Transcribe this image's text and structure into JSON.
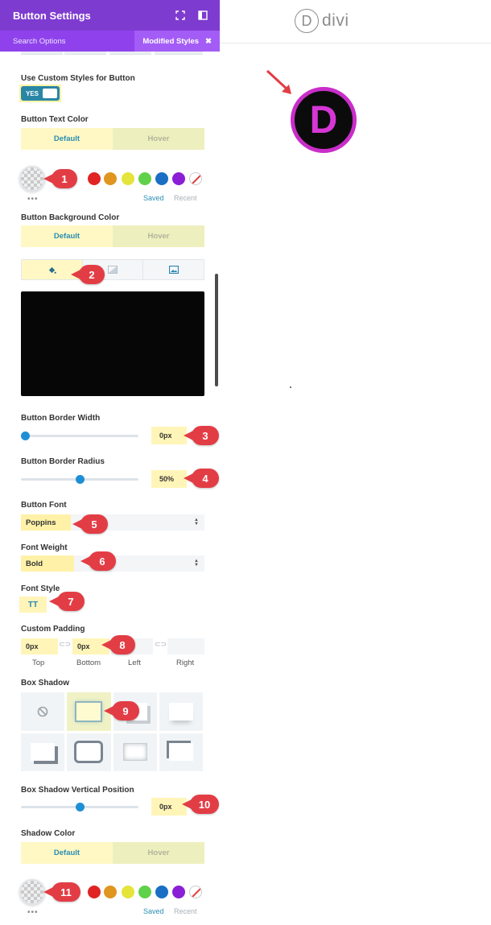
{
  "panel": {
    "title": "Button Settings",
    "search_options": "Search Options",
    "modified_styles": "Modified Styles"
  },
  "canvas": {
    "logo_letter": "D",
    "logo_word": "divi",
    "button_letter": "D"
  },
  "settings": {
    "use_custom_label": "Use Custom Styles for Button",
    "use_custom_value": "YES",
    "text_color_label": "Button Text Color",
    "bg_color_label": "Button Background Color",
    "tab_default": "Default",
    "tab_hover": "Hover",
    "saved": "Saved",
    "recent": "Recent",
    "border_width_label": "Button Border Width",
    "border_width_value": "0px",
    "border_width_level": 0,
    "border_radius_label": "Button Border Radius",
    "border_radius_value": "50%",
    "border_radius_level": 0.5,
    "font_label": "Button Font",
    "font_value": "Poppins",
    "weight_label": "Font Weight",
    "weight_value": "Bold",
    "style_label": "Font Style",
    "style_value": "TT",
    "padding_label": "Custom Padding",
    "padding_top": "0px",
    "padding_bottom": "0px",
    "pad_top_label": "Top",
    "pad_bottom_label": "Bottom",
    "pad_left_label": "Left",
    "pad_right_label": "Right",
    "box_shadow_label": "Box Shadow",
    "shadow_vpos_label": "Box Shadow Vertical Position",
    "shadow_vpos_value": "0px",
    "shadow_vpos_level": 0.5,
    "shadow_color_label": "Shadow Color"
  },
  "swatches": [
    "#e02424",
    "#e0951f",
    "#e4e43a",
    "#5fd14a",
    "#1a6fc4",
    "#8a1fd6"
  ],
  "badges": [
    "1",
    "2",
    "3",
    "4",
    "5",
    "6",
    "7",
    "8",
    "9",
    "10",
    "11"
  ],
  "colors": {
    "purple": "#7e3bd0",
    "accent_blue": "#2a8db3",
    "highlight": "#fff5b8",
    "badge_red": "#e23d45"
  }
}
